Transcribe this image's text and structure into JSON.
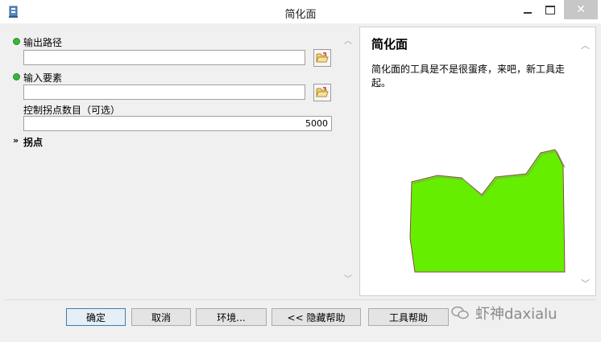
{
  "window": {
    "title": "简化面",
    "icons": {
      "app": "toolbox-icon",
      "minimize": "minimize-icon",
      "maximize": "maximize-icon",
      "close": "close-icon"
    }
  },
  "form": {
    "output_path": {
      "label": "输出路径",
      "value": ""
    },
    "input_features": {
      "label": "输入要素",
      "value": ""
    },
    "max_vertices": {
      "label": "控制拐点数目（可选）",
      "value": "5000"
    },
    "section": {
      "label": "拐点"
    }
  },
  "help": {
    "title": "简化面",
    "text": "简化面的工具是不是很蛋疼，来吧，新工具走起。",
    "image": {
      "fill": "#66ee00",
      "stroke": "#8a4a4a"
    }
  },
  "buttons": {
    "ok": "确定",
    "cancel": "取消",
    "env": "环境...",
    "hide_help": "<< 隐藏帮助",
    "tool_help": "工具帮助"
  },
  "watermark": {
    "text": "虾神daxialu"
  },
  "colors": {
    "required_dot": "#3bb43b",
    "close_button": "#c7c7c7"
  }
}
